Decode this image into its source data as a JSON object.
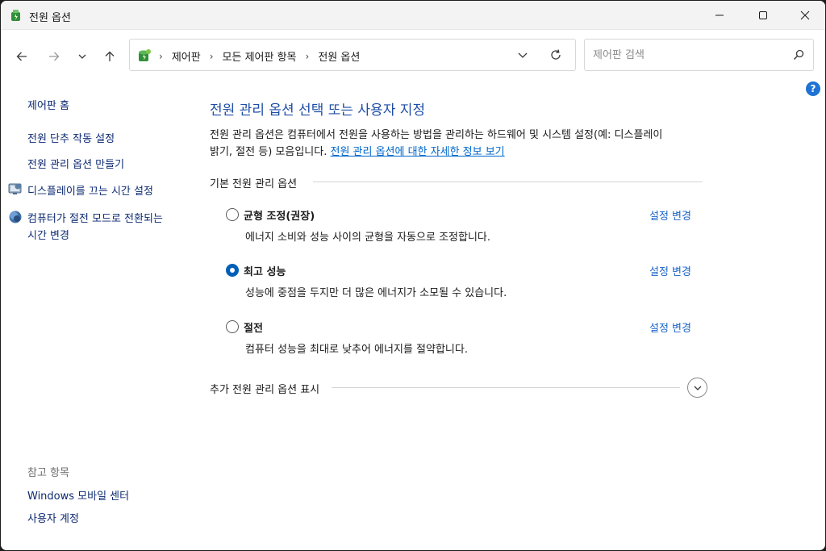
{
  "window": {
    "title": "전원 옵션"
  },
  "nav": {
    "breadcrumbs": [
      "제어판",
      "모든 제어판 항목",
      "전원 옵션"
    ],
    "separator": "›",
    "search_placeholder": "제어판 검색"
  },
  "help": {
    "label": "?"
  },
  "sidebar": {
    "links": [
      {
        "label": "제어판 홈",
        "icon": null
      },
      {
        "label": "전원 단추 작동 설정",
        "icon": null
      },
      {
        "label": "전원 관리 옵션 만들기",
        "icon": null
      },
      {
        "label": "디스플레이를 끄는 시간 설정",
        "icon": "monitor-icon"
      },
      {
        "label_line1": "컴퓨터가 절전 모드로 전환되는",
        "label_line2": "시간 변경",
        "icon": "globe-moon-icon"
      }
    ],
    "see_also": {
      "heading": "참고 항목",
      "links": [
        "Windows 모바일 센터",
        "사용자 계정"
      ]
    }
  },
  "main": {
    "title": "전원 관리 옵션 선택 또는 사용자 지정",
    "description_line1": "전원 관리 옵션은 컴퓨터에서 전원을 사용하는 방법을 관리하는 하드웨어 및 시스템 설정(예: 디스플레이",
    "description_line2": "밝기, 절전 등) 모음입니다.",
    "more_info_link": "전원 관리 옵션에 대한 자세한 정보 보기",
    "group_label": "기본 전원 관리 옵션",
    "plans": [
      {
        "name": "균형 조정(권장)",
        "description": "에너지 소비와 성능 사이의 균형을 자동으로 조정합니다.",
        "change_label": "설정 변경",
        "selected": false
      },
      {
        "name": "최고 성능",
        "description": "성능에 중점을 두지만 더 많은 에너지가 소모될 수 있습니다.",
        "change_label": "설정 변경",
        "selected": true
      },
      {
        "name": "절전",
        "description": "컴퓨터 성능을 최대로 낮추어 에너지를 절약합니다.",
        "change_label": "설정 변경",
        "selected": false
      }
    ],
    "extra_plans_label": "추가 전원 관리 옵션 표시"
  },
  "colors": {
    "accent": "#005fb8",
    "title_blue": "#1f4ea6",
    "link": "#0d2a73"
  }
}
